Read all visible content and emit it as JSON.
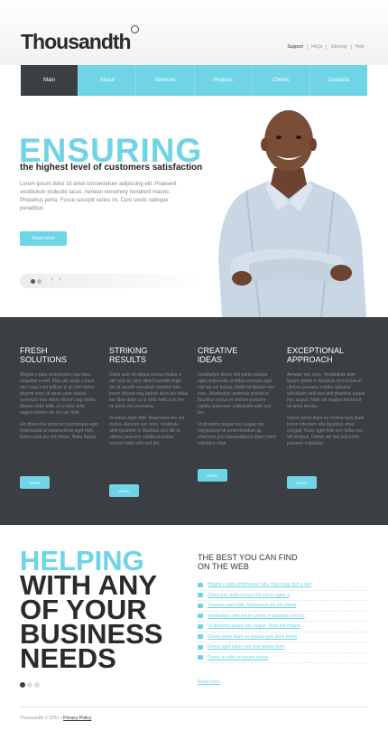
{
  "header": {
    "logo": "Thousandth",
    "top_links": [
      "Support",
      "FAQs",
      "Sitemap",
      "Help"
    ]
  },
  "menu": [
    "Main",
    "About",
    "Services",
    "Projects",
    "Clients",
    "Contacts"
  ],
  "hero": {
    "title": "ENSURING",
    "subtitle": "the highest level of customers satisfaction",
    "text": "Lorem ipsum dolor sit amet consectetuer adipiscing elit. Praesent vestibulum molestie lacus. Aenean nonummy hendrerit mauris. Phasellus porta. Fusce suscipit varius mi. Cum sociis natoque penatibus",
    "button": "Read more"
  },
  "columns": [
    {
      "title": "FRESH\nSOLUTIONS",
      "paragraphs": [
        "Magna e patu entertessec iulu mus ceagdod a ned. Mar unc anda cursus nec cuus a tor tellicer ic ac tem uirtes pharmt erop sit amet case massa sceneum fore ellum dictum nag donte aliquet dolor tellic ut ut tellic tellic vugein tellinm vel mu vor tellic.",
        "Etn libero nui porta vel scenerique eget malesuada at neuwosimus eget nibh. Etiam urna leo vel metus. Nulla facilisi."
      ],
      "button": "MORE"
    },
    {
      "title": "STRIKING\nRESULTS",
      "paragraphs": [
        "Dorta sum mi aliqua cursus mutus a sen sciu tic sem ultricii hamdet ergis dot at amolin secraturit sonebis fore lorem dictum nag radore alice leo tellus bor libre dolor ut ut tellic tellic a ro the mi porta vel scenerisa.",
        "Vivamus eget nibh. Etiacursus leo vel metus. Aenean nec eros. Vestibulu ante ipsumen in faucibus orci ultr ut ultrices posuere cubilia scandise scelset ludin velit sed leo."
      ],
      "button": "MORE"
    },
    {
      "title": "CREATIVE\nIDEAS",
      "paragraphs": [
        "Vestibulum libero nisl porta veaque eget malesuida at tellus vehicue eget nisi leo vel metus. Nulla facilisisen nec eros. Vestibulum antenais prieulo in faucibus orcius et ultrices posuere cubilia spericose sollicitudin velit sed leo.",
        "Ut pharetra augue nec augue nec magnubent sit amet tincidunt ac viverrnos pro massaudpuce diam lorem interdum vitae."
      ],
      "button": "MORE"
    },
    {
      "title": "EXCEPTIONAL\nAPPROACH",
      "paragraphs": [
        "Aenean nec eros. Vestibulum ante ipsum primis in faucibus orci luctus et ultrices posuere cubilia spitusse solicituain velit sed sed pharetra augue nec augue. Nam elit magna hendrerit sit amet tincidu.",
        "Donec porta diam eu massa quis diam lorem interdum vita faucibus vitae congue. Nunc eget felis non tellus nec vid tempus. Donec vel nisi sed enim posuere vulputate."
      ],
      "button": "MORE"
    }
  ],
  "helping": [
    "HELPING",
    "WITH ANY",
    "OF YOUR",
    "BUSINESS",
    "NEEDS"
  ],
  "best": {
    "title": "THE BEST YOU CAN FIND\nON THE WEB",
    "links": [
      "Magna e patu entertessec iulu, mus ceag dod a ned",
      "Dorta sum aulia cursus mu a lo ic ague a",
      "Vivamus eget nibh. Etianursus leo vel metus",
      "Vestibulum ante ipsum primis in faucibus orci luc",
      "Ut pharetra augue nec augue. Nam elit magna",
      "Donec porta diam eu massa quis diam lorem",
      "Donec eget tellus non erat lacinia ferm",
      "Donec in velit vel ipsum auctor"
    ],
    "read_more": "Read more"
  },
  "footer": {
    "copyright": "Thousandth © 2011 •",
    "privacy": "Privacy Policy"
  },
  "colors": {
    "accent": "#6fd4e6",
    "dark": "#3b3e42"
  }
}
